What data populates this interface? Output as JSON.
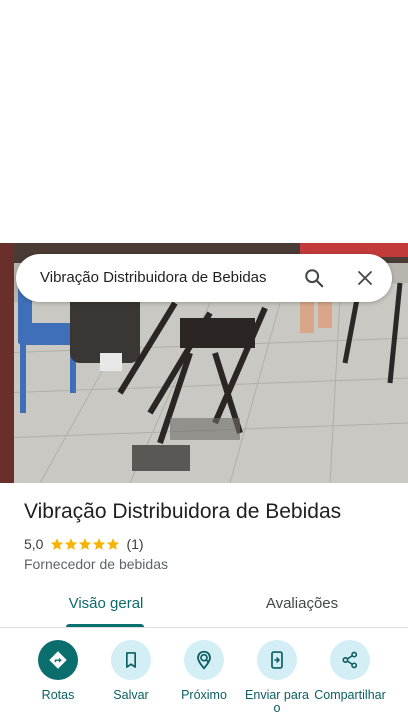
{
  "search": {
    "query": "Vibração Distribuidora de Bebidas"
  },
  "place": {
    "title": "Vibração Distribuidora de Bebidas",
    "rating": "5,0",
    "stars": 5,
    "review_count": "(1)",
    "category": "Fornecedor de bebidas"
  },
  "tabs": [
    {
      "label": "Visão geral",
      "selected": true
    },
    {
      "label": "Avaliações",
      "selected": false
    }
  ],
  "actions": [
    {
      "label": "Rotas",
      "icon": "directions-icon"
    },
    {
      "label": "Salvar",
      "icon": "bookmark-icon"
    },
    {
      "label": "Próximo",
      "icon": "nearby-icon"
    },
    {
      "label": "Enviar para o",
      "icon": "send-to-phone-icon"
    },
    {
      "label": "Compartilhar",
      "icon": "share-icon"
    }
  ],
  "colors": {
    "accent": "#0b6e6e",
    "action_bg": "#d3eef4",
    "star": "#f4b400"
  }
}
